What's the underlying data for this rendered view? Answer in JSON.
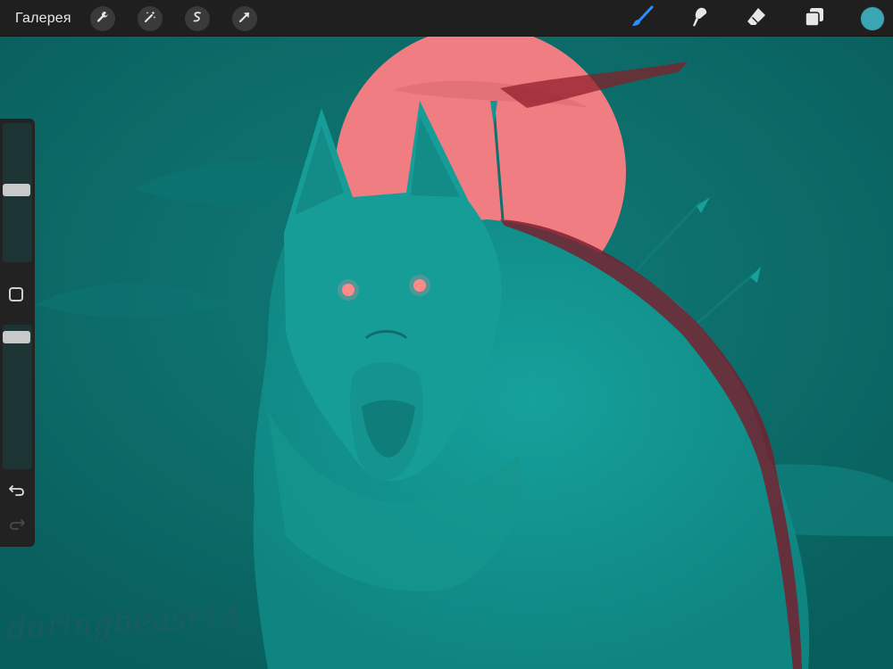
{
  "toolbar": {
    "gallery_label": "Галерея",
    "left_tools": [
      "wrench-icon",
      "magic-wand-icon",
      "selection-icon",
      "transform-arrow-icon"
    ],
    "right_tools": [
      "brush-icon",
      "smudge-icon",
      "eraser-icon",
      "layers-icon"
    ],
    "active_tool": "brush-icon",
    "current_color": "#3aa6b4"
  },
  "sidebar": {
    "brush_size_level": 0.5,
    "opacity_level": 0.0,
    "controls": [
      "modify-button",
      "undo-icon",
      "redo-icon"
    ]
  },
  "canvas": {
    "signature": "daringbeast14",
    "colors": {
      "background": "#0b6e6b",
      "moon": "#f07d82",
      "wolf": "#139591",
      "eyes": "#ff8a8a",
      "fur_shadow": "#7a1a2a"
    }
  }
}
